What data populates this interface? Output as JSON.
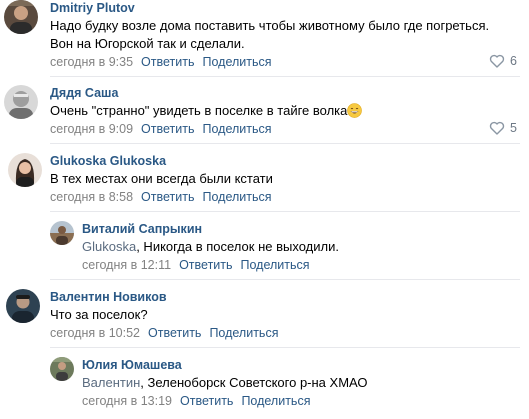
{
  "comments": [
    {
      "author": "Dmitriy Plutov",
      "lines": [
        "Надо будку возле дома поставить чтобы животному было где погреться.",
        "Вон на Югорской так и сделали."
      ],
      "time": "сегодня в 9:35",
      "reply": "Ответить",
      "share": "Поделиться",
      "likes": "6",
      "avatar_icon": "person-photo-dark"
    },
    {
      "author": "Дядя Саша",
      "text": "Очень \"странно\" увидеть в поселке в тайге волка",
      "emoji": "grinning-face-emoji",
      "time": "сегодня в 9:09",
      "reply": "Ответить",
      "share": "Поделиться",
      "likes": "5",
      "avatar_icon": "person-photo-gray"
    },
    {
      "author": "Glukoska Glukoska",
      "text": "В тех местах они всегда были кстати",
      "time": "сегодня в 8:58",
      "reply": "Ответить",
      "share": "Поделиться",
      "avatar_icon": "woman-photo"
    },
    {
      "author": "Виталий Сапрыкин",
      "mention": "Glukoska",
      "text": ", Никогда в поселок не выходили.",
      "time": "сегодня в 12:11",
      "reply": "Ответить",
      "share": "Поделиться",
      "avatar_icon": "person-photo-landscape"
    },
    {
      "author": "Валентин Новиков",
      "text": "Что за поселок?",
      "time": "сегодня в 10:52",
      "reply": "Ответить",
      "share": "Поделиться",
      "avatar_icon": "person-photo-dark-blue"
    },
    {
      "author": "Юлия Юмашева",
      "mention": "Валентин",
      "text": ", Зеленоборск Советского р-на ХМАО",
      "time": "сегодня в 13:19",
      "reply": "Ответить",
      "share": "Поделиться",
      "avatar_icon": "person-photo-outdoor"
    }
  ],
  "colors": {
    "author": "#2a5885",
    "action": "#2a5885",
    "meta": "#828282",
    "separator": "#e7e8ec"
  }
}
